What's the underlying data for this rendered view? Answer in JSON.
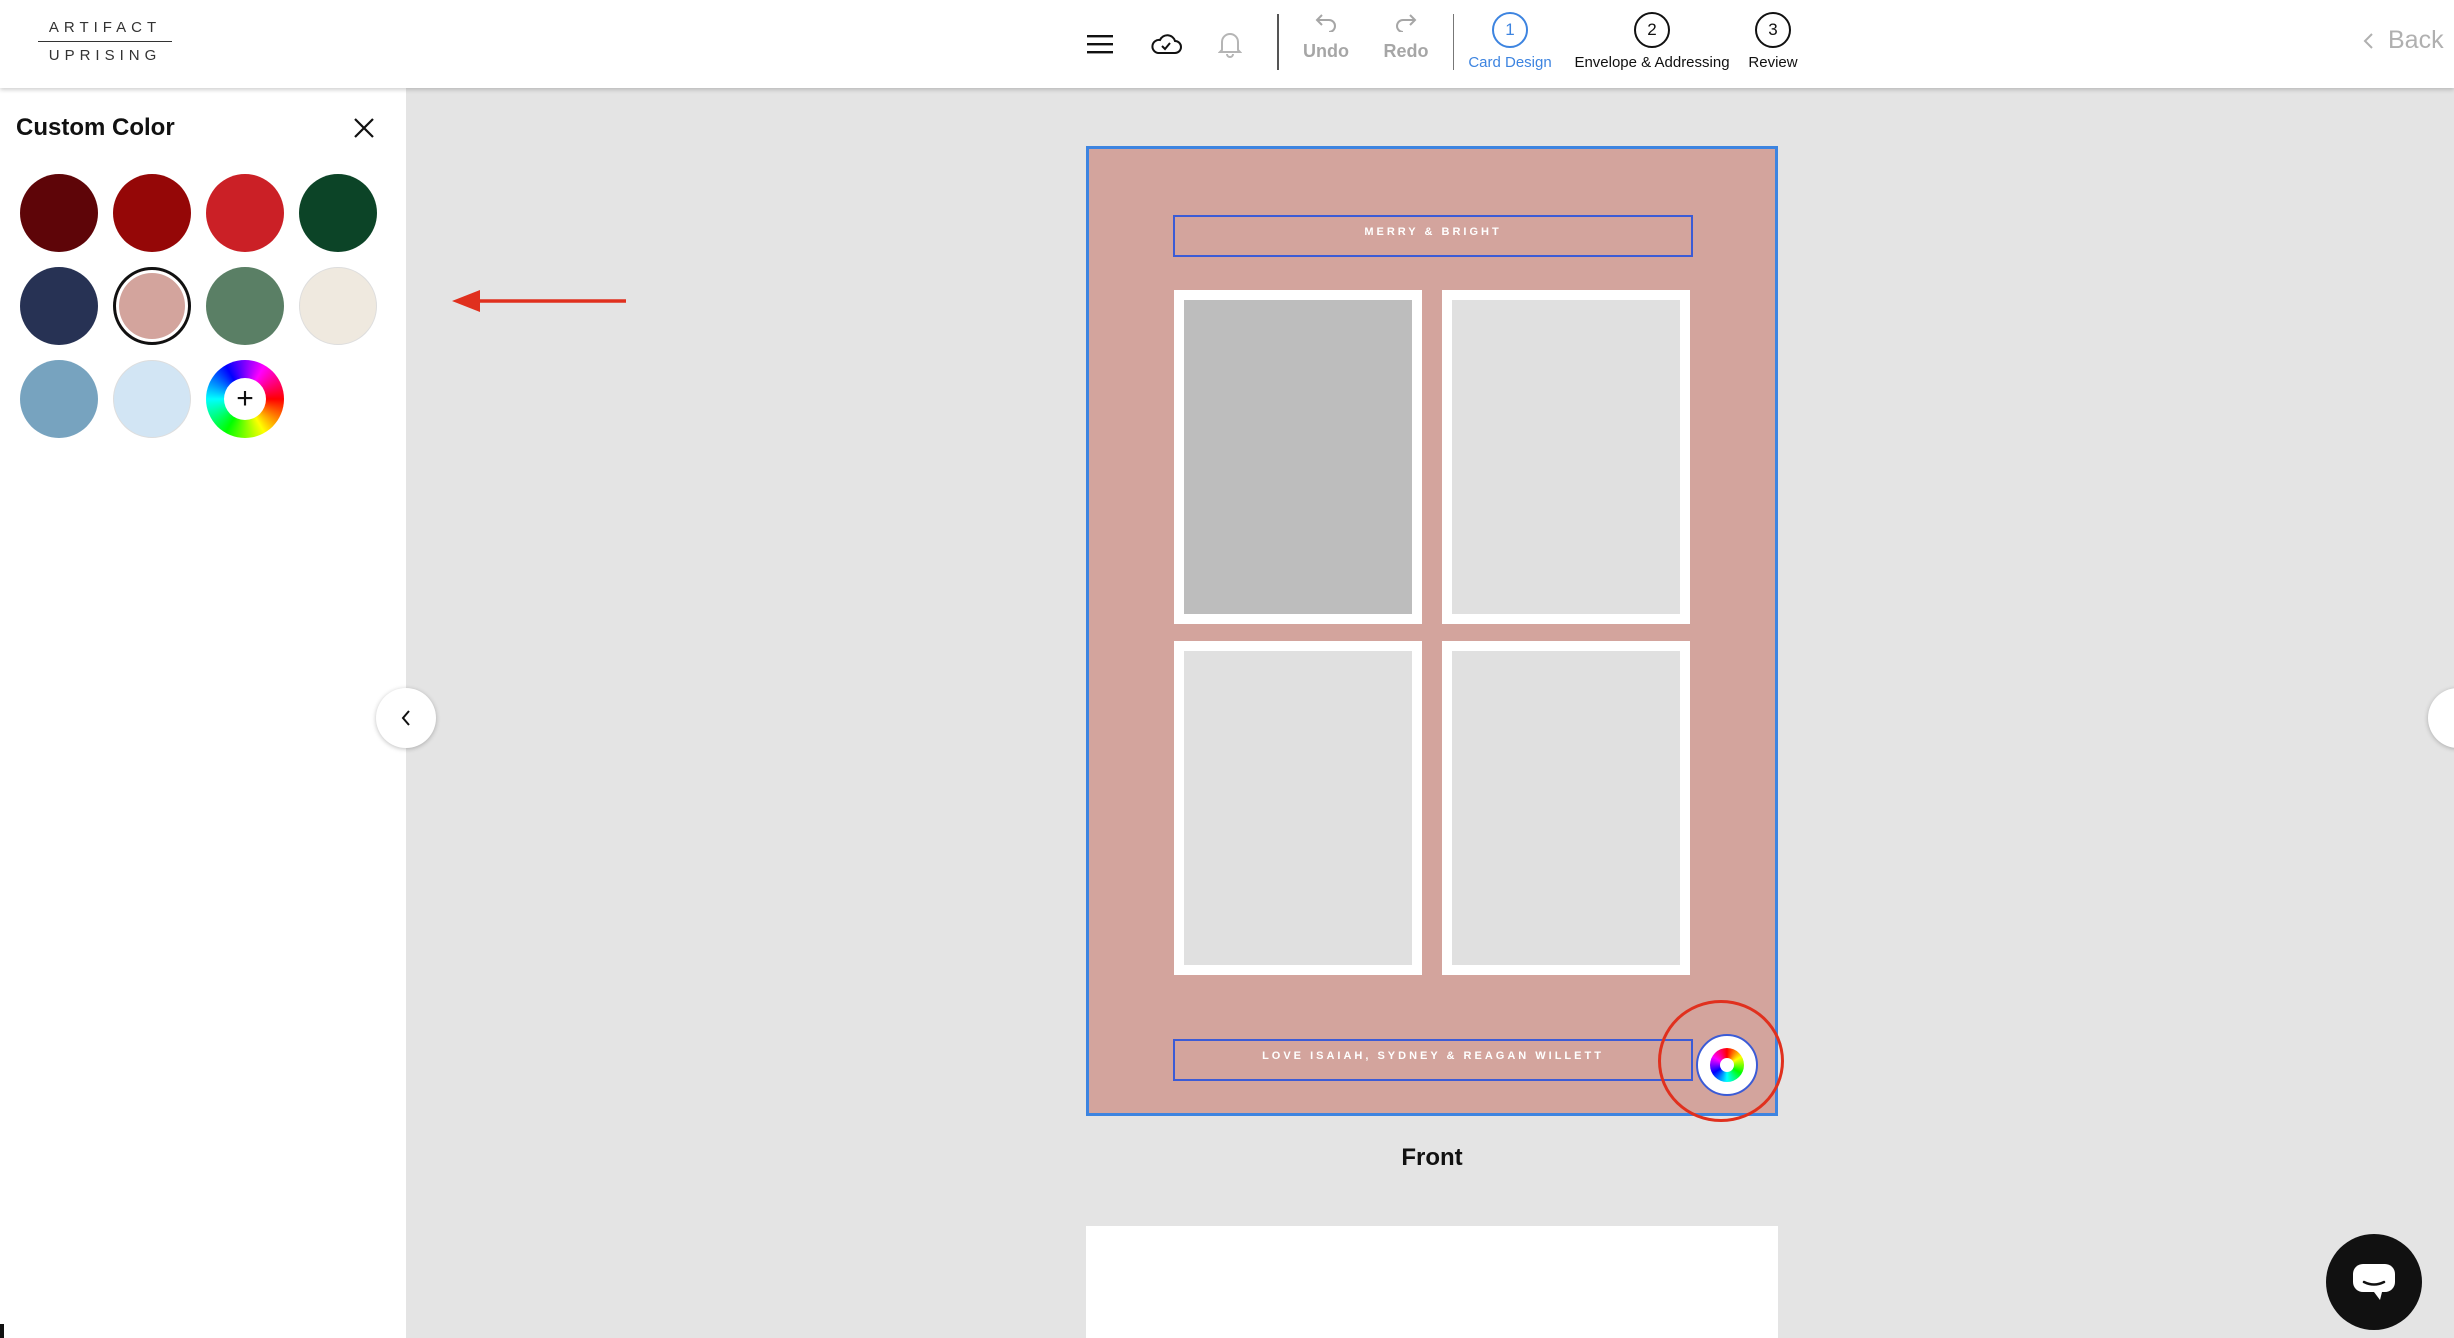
{
  "brand": {
    "line1": "ARTIFACT",
    "line2": "UPRISING"
  },
  "toolbar": {
    "undo_label": "Undo",
    "redo_label": "Redo",
    "back_label": "Back",
    "steps": [
      {
        "number": "1",
        "label": "Card Design",
        "active": true
      },
      {
        "number": "2",
        "label": "Envelope & Addressing",
        "active": false
      },
      {
        "number": "3",
        "label": "Review",
        "active": false
      }
    ]
  },
  "panel": {
    "title": "Custom Color",
    "swatches": [
      {
        "color": "#5e0508"
      },
      {
        "color": "#950707"
      },
      {
        "color": "#cb2026"
      },
      {
        "color": "#0c4427"
      },
      {
        "color": "#273254"
      },
      {
        "color": "#d3a49d",
        "selected": true
      },
      {
        "color": "#5a7f65"
      },
      {
        "color": "#efe9df"
      },
      {
        "color": "#77a3bf"
      },
      {
        "color": "#d2e5f4"
      }
    ],
    "custom_icon": "color-wheel-add-icon"
  },
  "card": {
    "background": "#d3a49d",
    "top_text": "MERRY & BRIGHT",
    "bottom_text": "LOVE ISAIAH, SYDNEY & REAGAN WILLETT",
    "label": "Front"
  },
  "colors": {
    "accent": "#3d84e0",
    "annotation": "#e0301e"
  }
}
